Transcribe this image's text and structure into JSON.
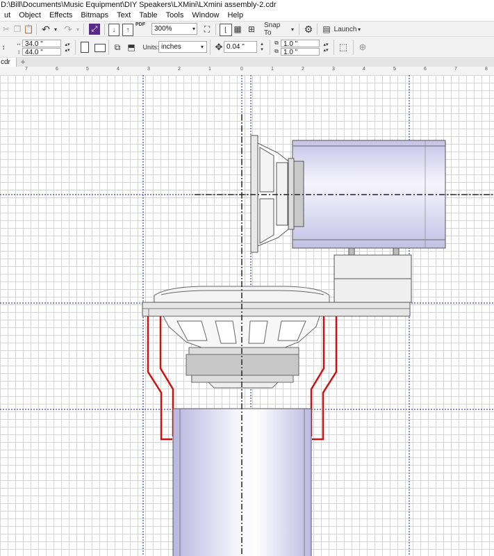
{
  "window": {
    "title": "D:\\Bill\\Documents\\Music Equipment\\DIY Speakers\\LXMini\\LXmini assembly-2.cdr"
  },
  "menu": [
    "ut",
    "Object",
    "Effects",
    "Bitmaps",
    "Text",
    "Table",
    "Tools",
    "Window",
    "Help"
  ],
  "toolbar": {
    "pdf_label": "PDF",
    "zoom_value": "300%",
    "snap_label": "Snap To",
    "launch_label": "Launch"
  },
  "property_bar": {
    "width_value": "34.0 \"",
    "height_value": "44.0 \"",
    "units_label": "Units:",
    "units_value": "inches",
    "nudge_value": "0.04 \"",
    "dup_x_value": "1.0 \"",
    "dup_y_value": "1.0 \""
  },
  "tabs": {
    "doc_tab": "cdr",
    "add_tab": "+"
  },
  "ruler": {
    "labels": [
      "7",
      "6",
      "5",
      "4",
      "3",
      "2",
      "1",
      "0",
      "1",
      "2",
      "3",
      "4",
      "5",
      "6",
      "7",
      "8"
    ]
  },
  "colors": {
    "accent_red": "#d01010",
    "pipe_fill": "#c9c7e6",
    "guide_blue": "#1a1aa0",
    "toolbar_bg": "#f2f2f2"
  }
}
